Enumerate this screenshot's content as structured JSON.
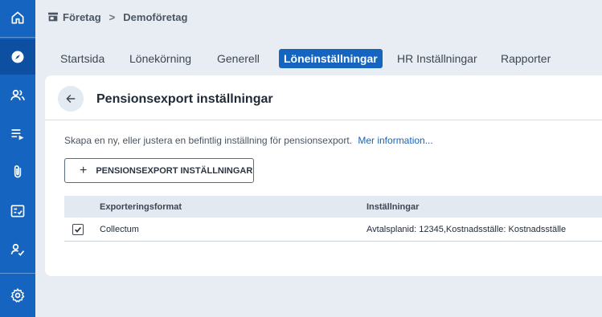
{
  "breadcrumb": {
    "company_label": "Företag",
    "separator": ">",
    "current": "Demoföretag"
  },
  "sidebar": {
    "items": [
      {
        "icon": "home-icon"
      },
      {
        "icon": "compass-icon",
        "active": true
      },
      {
        "icon": "users-icon"
      },
      {
        "icon": "list-play-icon"
      },
      {
        "icon": "paperclip-icon"
      },
      {
        "icon": "checklist-icon"
      },
      {
        "icon": "user-check-icon"
      },
      {
        "icon": "gear-icon"
      }
    ]
  },
  "tabs": [
    {
      "label": "Startsida"
    },
    {
      "label": "Lönekörning"
    },
    {
      "label": "Generell"
    },
    {
      "label": "Löneinställningar",
      "active": true
    },
    {
      "label": "HR Inställningar"
    },
    {
      "label": "Rapporter"
    }
  ],
  "page": {
    "title": "Pensionsexport inställningar",
    "description": "Skapa en ny, eller justera en befintlig inställning för pensionsexport.",
    "more_info_link": "Mer information...",
    "add_button_label": "PENSIONSEXPORT INSTÄLLNINGAR"
  },
  "table": {
    "columns": [
      "Exporteringsformat",
      "Inställningar"
    ],
    "rows": [
      {
        "checked": true,
        "format": "Collectum",
        "settings": "Avtalsplanid: 12345,Kostnadsställe: Kostnadsställe"
      }
    ]
  },
  "colors": {
    "accent": "#1565c0",
    "background": "#e8edf3",
    "card": "#ffffff"
  }
}
